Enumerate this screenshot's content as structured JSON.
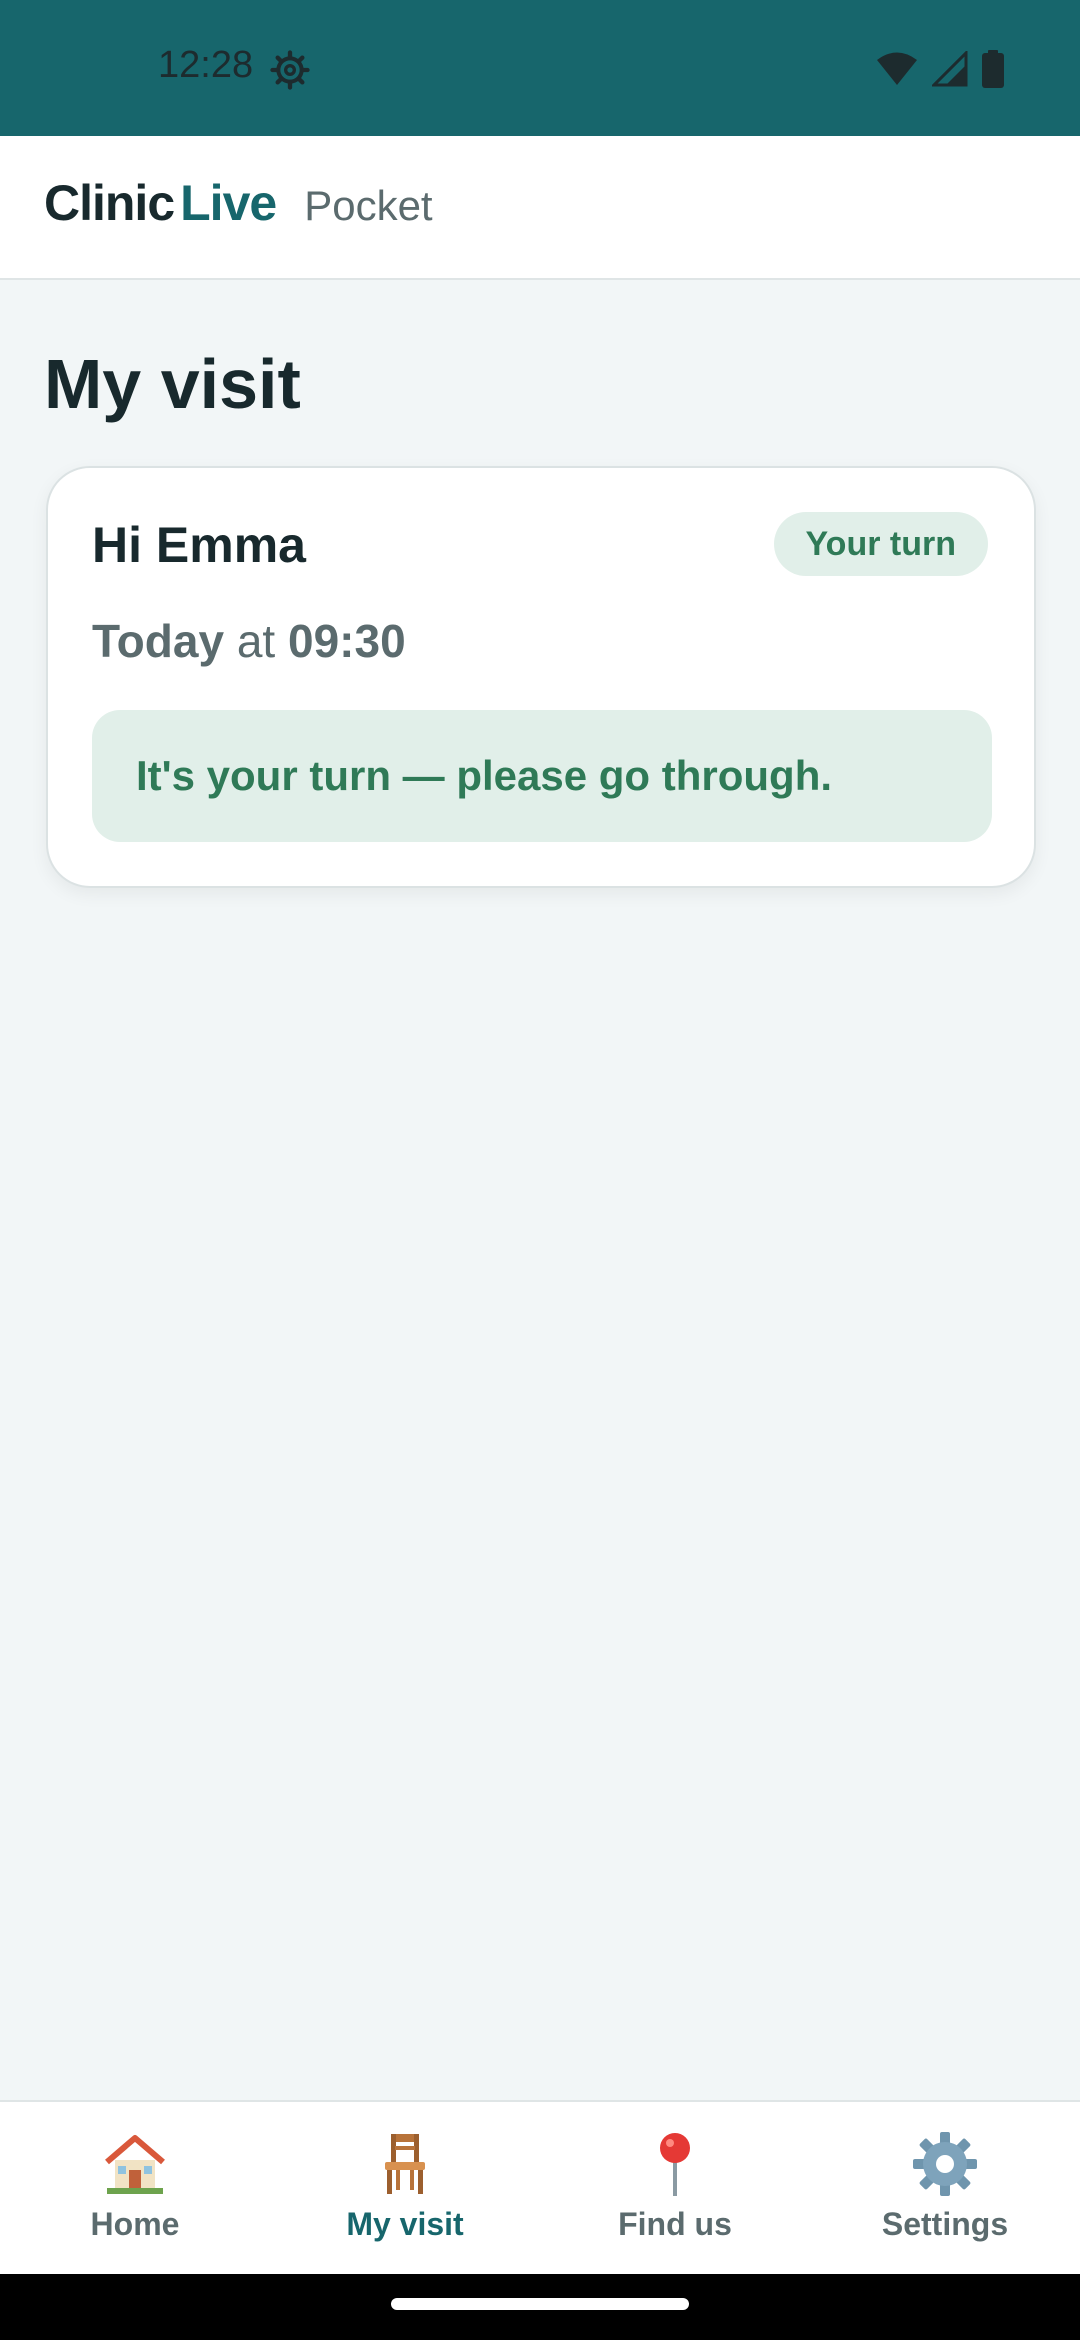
{
  "status_bar": {
    "time": "12:28",
    "background": "#17666c",
    "icons": [
      "settings-gear-icon",
      "wifi-icon",
      "cellular-signal-icon",
      "battery-icon"
    ]
  },
  "header": {
    "brand_part1": "Clinic",
    "brand_part2": "Live",
    "subtitle": "Pocket",
    "accent": "#17666c"
  },
  "page": {
    "title": "My visit"
  },
  "visit_card": {
    "greeting": "Hi Emma",
    "badge": "Your turn",
    "day": "Today",
    "at": "at",
    "time": "09:30",
    "message": "It's your turn — please go through.",
    "status_color": "#2f7a57"
  },
  "bottom_nav": {
    "items": [
      {
        "label": "Home",
        "icon": "house-icon",
        "active": false
      },
      {
        "label": "My visit",
        "icon": "chair-icon",
        "active": true
      },
      {
        "label": "Find us",
        "icon": "map-pin-icon",
        "active": false
      },
      {
        "label": "Settings",
        "icon": "gear-icon",
        "active": false
      }
    ]
  }
}
